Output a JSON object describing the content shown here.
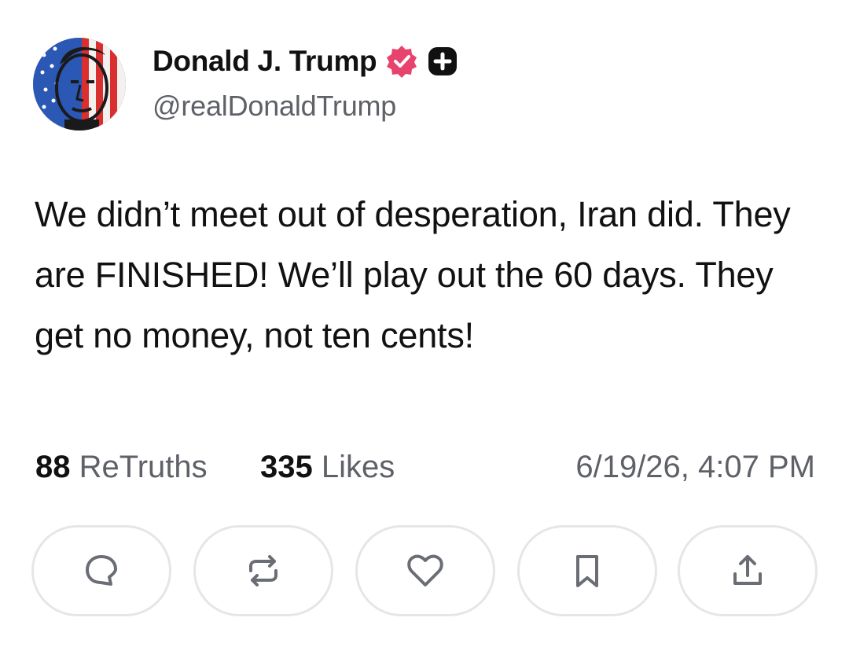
{
  "author": {
    "display_name": "Donald J. Trump",
    "handle": "@realDonaldTrump",
    "verified_badge_color": "#e8426f"
  },
  "post": {
    "text": "We didn’t meet out of desperation, Iran did. They are FINISHED! We’ll play out the 60 days. They get no money, not ten cents!"
  },
  "stats": {
    "retruths_count": "88",
    "retruths_label": "ReTruths",
    "likes_count": "335",
    "likes_label": "Likes",
    "timestamp": "6/19/26, 4:07 PM"
  },
  "actions": [
    {
      "icon": "reply-icon"
    },
    {
      "icon": "retruth-icon"
    },
    {
      "icon": "like-icon"
    },
    {
      "icon": "bookmark-icon"
    },
    {
      "icon": "share-icon"
    }
  ],
  "colors": {
    "text_primary": "#111111",
    "text_secondary": "#5f6168",
    "button_border": "#e6e6e9"
  }
}
